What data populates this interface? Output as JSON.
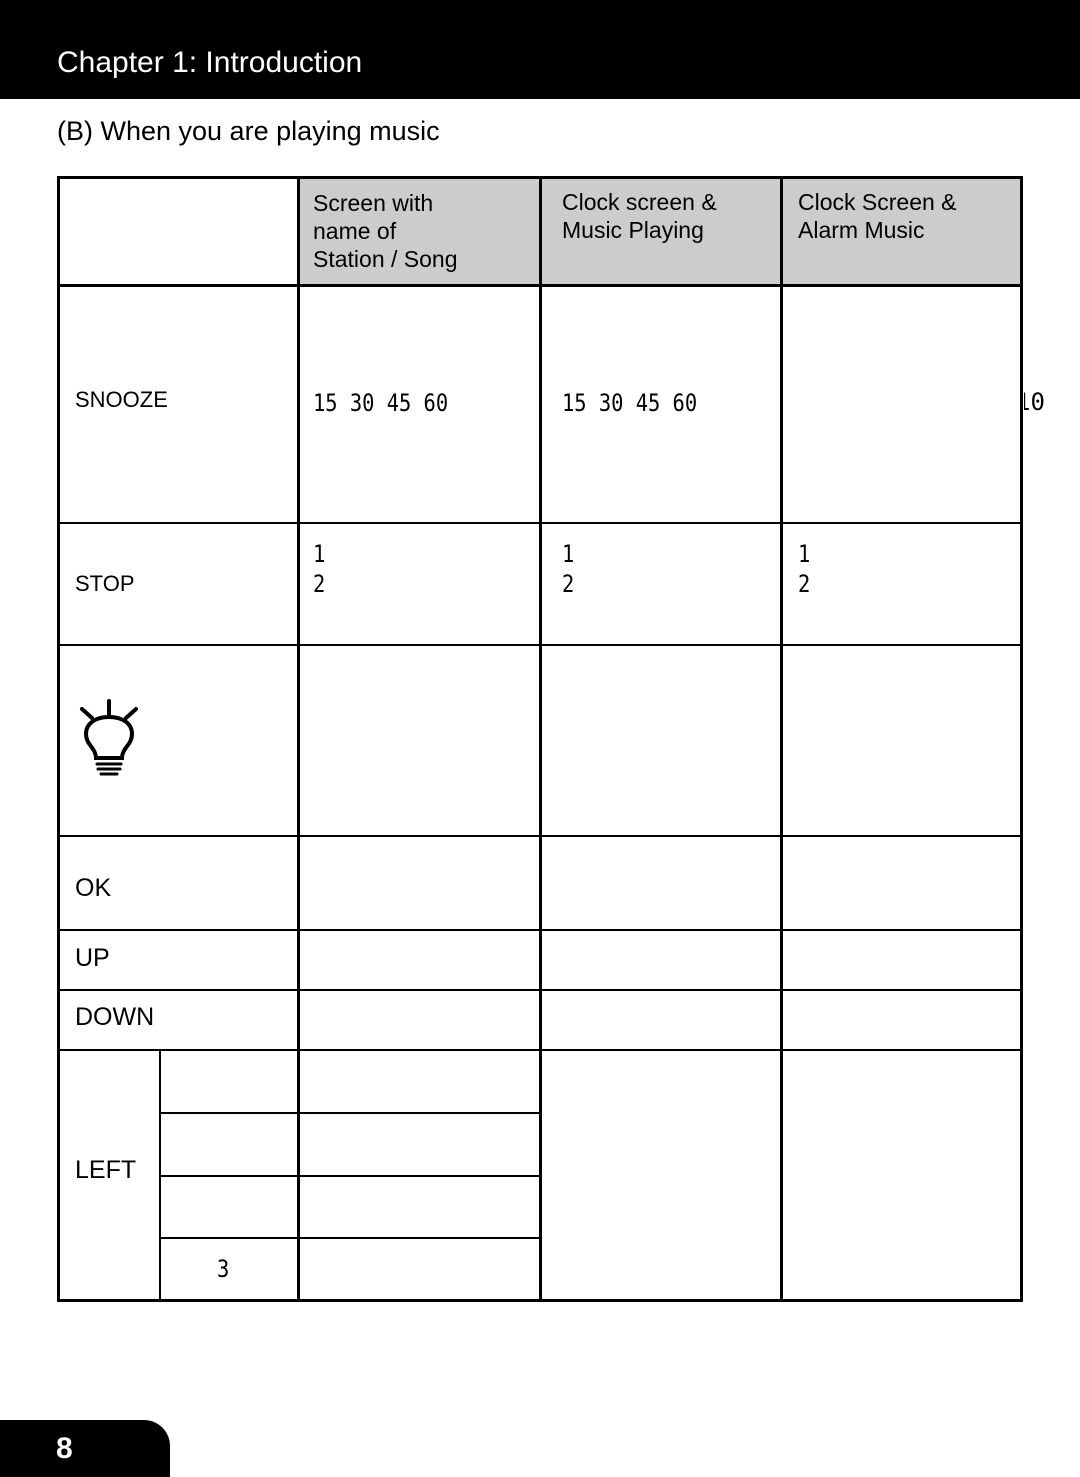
{
  "header": {
    "chapter_title": "Chapter 1: Introduction"
  },
  "section": {
    "title": "(B) When you are playing music"
  },
  "table": {
    "columns": [
      "",
      "Screen with\nname of\nStation / Song",
      "Clock screen &\nMusic Playing",
      "Clock Screen &\nAlarm Music"
    ],
    "rows": {
      "snooze": {
        "label": "SNOOZE",
        "station_song": "15  30  45  60",
        "clock_music": "15  30  45  60",
        "clock_alarm": "",
        "overflow_text": "10"
      },
      "stop": {
        "label": "STOP",
        "station_song": "1\n2",
        "clock_music": "1\n2",
        "clock_alarm": "1\n2"
      },
      "light": {
        "icon": "lightbulb-icon"
      },
      "ok": {
        "label": "OK"
      },
      "up": {
        "label": "UP"
      },
      "down": {
        "label": "DOWN"
      },
      "left": {
        "label": "LEFT",
        "sub_rows": [
          "",
          "",
          "",
          "3"
        ]
      }
    }
  },
  "footer": {
    "page_number": "8"
  }
}
